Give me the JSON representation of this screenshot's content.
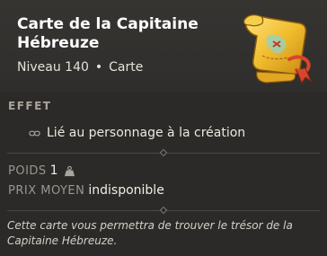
{
  "item": {
    "name": "Carte de la Capitaine Hébreuze",
    "level_text": "Niveau 140",
    "separator": "•",
    "type": "Carte"
  },
  "effects": {
    "header": "EFFET",
    "lines": [
      "Lié au personnage à la création"
    ]
  },
  "stats": {
    "weight_label": "POIDS",
    "weight_value": "1",
    "price_label": "PRIX MOYEN",
    "price_value": "indisponible"
  },
  "description": "Cette carte vous permettra de trouver le trésor de la Capitaine Hébreuze.",
  "colors": {
    "background": "#2c2a28",
    "map_gold": "#e8b42a",
    "ribbon_red": "#d8452b"
  },
  "icons": [
    "treasure-map-icon",
    "link-icon",
    "weight-icon"
  ]
}
